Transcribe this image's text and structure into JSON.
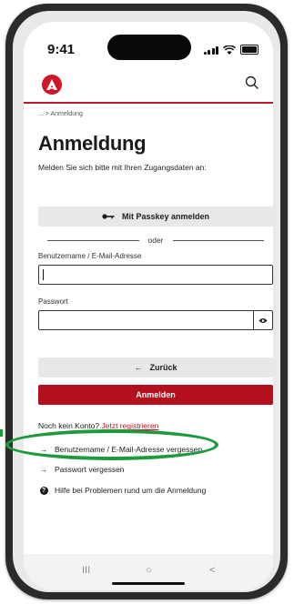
{
  "status": {
    "time": "9:41"
  },
  "breadcrumb": {
    "prefix": "...",
    "sep": ">",
    "current": "Anmeldung"
  },
  "page": {
    "title": "Anmeldung",
    "intro": "Melden Sie sich bitte mit Ihren Zugangsdaten an:"
  },
  "passkey": {
    "label": "Mit Passkey anmelden",
    "icon": "key-icon"
  },
  "divider": {
    "text": "oder"
  },
  "form": {
    "username_label": "Benutzername / E-Mail-Adresse",
    "username_value": "",
    "password_label": "Passwort",
    "password_value": ""
  },
  "buttons": {
    "back": "Zurück",
    "back_arrow": "←",
    "login": "Anmelden"
  },
  "register": {
    "text": "Noch kein Konto?",
    "link": "Jetzt registrieren"
  },
  "links": [
    {
      "arrow": "→",
      "label": "Benutzername / E-Mail-Adresse vergessen"
    },
    {
      "arrow": "→",
      "label": "Passwort vergessen"
    },
    {
      "label": "Hilfe bei Problemen rund um die Anmeldung",
      "icon": "help-icon"
    }
  ],
  "nav": {
    "recent": "III",
    "home": "○",
    "back": "<"
  },
  "colors": {
    "brand": "#c0152a",
    "primary_button": "#b5101e",
    "highlight": "#1c9a3c"
  }
}
